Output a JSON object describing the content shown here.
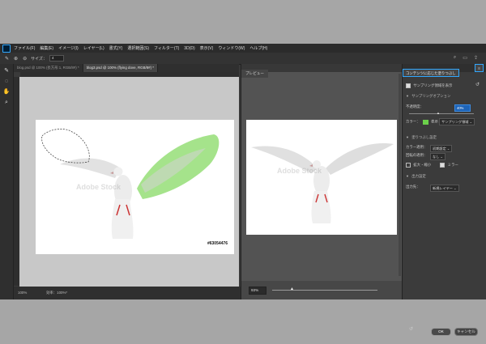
{
  "menubar": {
    "items": [
      "ファイル(F)",
      "編集(E)",
      "イメージ(I)",
      "レイヤー(L)",
      "書式(Y)",
      "選択範囲(S)",
      "フィルター(T)",
      "3D(D)",
      "表示(V)",
      "ウィンドウ(W)",
      "ヘルプ(H)"
    ]
  },
  "options": {
    "size_label": "サイズ：",
    "size_value": "4"
  },
  "tabs": [
    {
      "label": "blog.psd @ 100% (長方形 1, RGB/8#) *",
      "active": false
    },
    {
      "label": "blog3.psd @ 100% (flying dove, RGB/8#) *",
      "active": true
    }
  ],
  "document": {
    "image_id": "#63054476",
    "watermark": "Adobe Stock"
  },
  "status": {
    "zoom": "100%",
    "efficiency": "効率：100%*"
  },
  "preview": {
    "title": "プレビュー",
    "zoom": "93%",
    "watermark": "Adobe Stock"
  },
  "side_panel": {
    "title": "コンテンツに応じた塗りつぶし",
    "show_sampling_area": "サンプリング領域を表示",
    "sampling_options": "サンプリングオプション",
    "opacity_label": "不透明度：",
    "opacity_value": "40%",
    "color_label": "カラー：",
    "indicate_label": "表示",
    "indicate_value": "サンプリング領域",
    "fill_settings": "塗りつぶし設定",
    "color_adapt_label": "カラー適用：",
    "color_adapt_value": "初期設定",
    "rotation_label": "回転の適用：",
    "rotation_value": "なし",
    "scale_label": "拡大・縮小",
    "mirror_label": "ミラー",
    "output_settings": "出力設定",
    "output_to_label": "出力先：",
    "output_to_value": "新規レイヤー",
    "ok": "OK",
    "cancel": "キャンセル"
  },
  "colors": {
    "accent": "#31a8ff",
    "sampling": "#6bd04a"
  }
}
